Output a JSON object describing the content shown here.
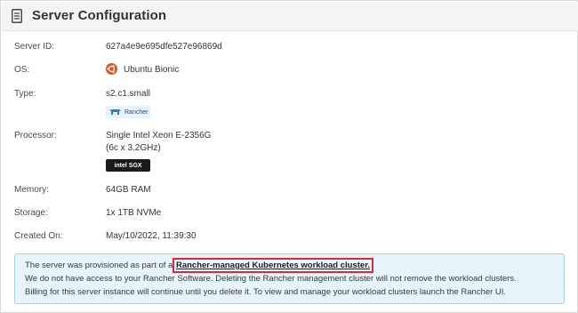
{
  "header": {
    "title": "Server Configuration",
    "icon": "server-config-icon"
  },
  "server_id": {
    "label": "Server ID:",
    "value": "627a4e9e695dfe527e96869d"
  },
  "os": {
    "label": "OS:",
    "value": "Ubuntu Bionic",
    "icon": "ubuntu-icon",
    "icon_color": "#e95420"
  },
  "type": {
    "label": "Type:",
    "value": "s2.c1.small",
    "badge": "Rancher"
  },
  "processor": {
    "label": "Processor:",
    "line1": "Single Intel Xeon E-2356G",
    "line2": "(6c x 3.2GHz)",
    "badge": "intel SGX"
  },
  "memory": {
    "label": "Memory:",
    "value": "64GB RAM"
  },
  "storage": {
    "label": "Storage:",
    "value": "1x 1TB NVMe"
  },
  "created": {
    "label": "Created On:",
    "value": "May/10/2022, 11:39:30"
  },
  "notice": {
    "line1_prefix": "The server was provisioned as part of a ",
    "line1_link": "Rancher-managed Kubernetes workload cluster.",
    "line2": "We do not have access to your Rancher Software. Deleting the Rancher management cluster will not remove the workload clusters.",
    "line3": "Billing for this server instance will continue until you delete it. To view and manage your workload clusters launch the Rancher UI."
  },
  "colors": {
    "highlight_border": "#e0283a",
    "notice_bg": "#e7f4fa",
    "notice_border": "#a8d4e8"
  }
}
